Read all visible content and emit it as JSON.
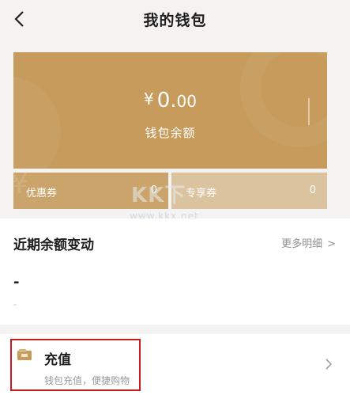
{
  "header": {
    "title": "我的钱包",
    "back_icon": "chevron-left-icon"
  },
  "wallet": {
    "currency_symbol": "¥",
    "amount_int": "0.",
    "amount_dec": "00",
    "balance_label": "钱包余额",
    "accent_color": "#c69b5b"
  },
  "stats": [
    {
      "label": "优惠券",
      "value": "0"
    },
    {
      "label": "专享券",
      "value": "0"
    }
  ],
  "watermark": {
    "logo": "KK下载",
    "url": "www.kkx.net"
  },
  "recent": {
    "title": "近期余额变动",
    "more_label": "更多明细",
    "placeholder": "-",
    "placeholder_sub": "-"
  },
  "recharge": {
    "title": "充值",
    "desc": "钱包充值，便捷购物",
    "icon": "wallet-icon",
    "highlight_color": "#c8191f"
  }
}
